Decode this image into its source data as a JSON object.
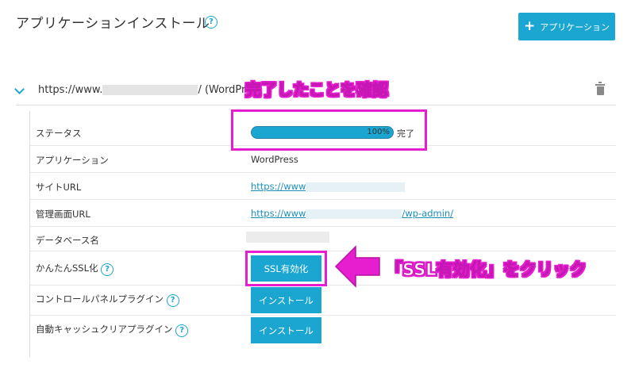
{
  "header": {
    "title": "アプリケーションインストール",
    "help_icon": "?",
    "add_button_label": "アプリケーション"
  },
  "app_row": {
    "url_prefix": "https://www.",
    "url_suffix": "/ (WordPress"
  },
  "fields": {
    "status_label": "ステータス",
    "status_percent": "100%",
    "status_progress": 100,
    "status_text": "完了",
    "application_label": "アプリケーション",
    "application_value": "WordPress",
    "site_url_label": "サイトURL",
    "site_url_value": "https://www",
    "admin_url_label": "管理画面URL",
    "admin_url_prefix": "https://www",
    "admin_url_suffix": "/wp-admin/",
    "db_label": "データベース名",
    "ssl_label": "かんたんSSL化",
    "ssl_button": "SSL有効化",
    "panel_plugin_label": "コントロールパネルプラグイン",
    "panel_plugin_button": "インストール",
    "cache_plugin_label": "自動キャッシュクリアプラグイン",
    "cache_plugin_button": "インストール"
  },
  "annotations": {
    "callout_status": "完了したことを確認",
    "callout_ssl": "「SSL有効化」をクリック",
    "accent": "#e51fd0"
  },
  "colors": {
    "primary": "#1ba6d1"
  }
}
